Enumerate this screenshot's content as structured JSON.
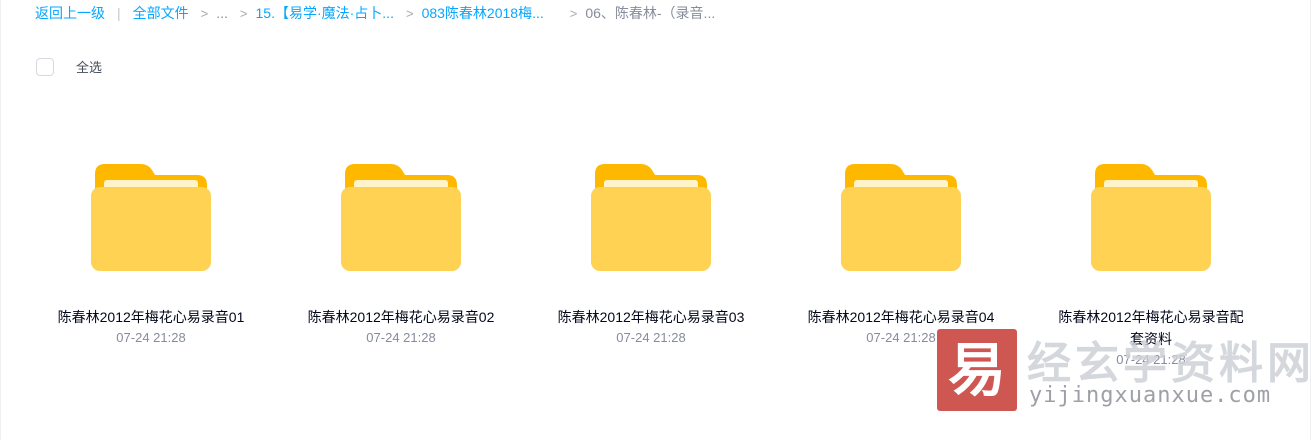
{
  "breadcrumb": {
    "back": "返回上一级",
    "all_files": "全部文件",
    "ellipsis": "...",
    "crumb1": "15.【易学·魔法·占卜...",
    "crumb2": "083陈春林2018梅...",
    "current": "06、陈春林-（录音..."
  },
  "toolbar": {
    "select_all_label": "全选"
  },
  "folders": [
    {
      "name": "陈春林2012年梅花心易录音01",
      "date": "07-24 21:28",
      "icon": "folder-icon"
    },
    {
      "name": "陈春林2012年梅花心易录音02",
      "date": "07-24 21:28",
      "icon": "folder-icon"
    },
    {
      "name": "陈春林2012年梅花心易录音03",
      "date": "07-24 21:28",
      "icon": "folder-icon"
    },
    {
      "name": "陈春林2012年梅花心易录音04",
      "date": "07-24 21:28",
      "icon": "folder-icon"
    },
    {
      "name": "陈春林2012年梅花心易录音配套资料",
      "date": "07-24 21:28",
      "icon": "folder-icon"
    }
  ],
  "watermark": {
    "seal_char": "易",
    "title": "经玄学资料网",
    "url": "yijingxuanxue.com"
  },
  "colors": {
    "link": "#06a7ff",
    "folder_front": "#ffd254",
    "folder_back": "#ffb800",
    "seal": "#c9403a"
  }
}
